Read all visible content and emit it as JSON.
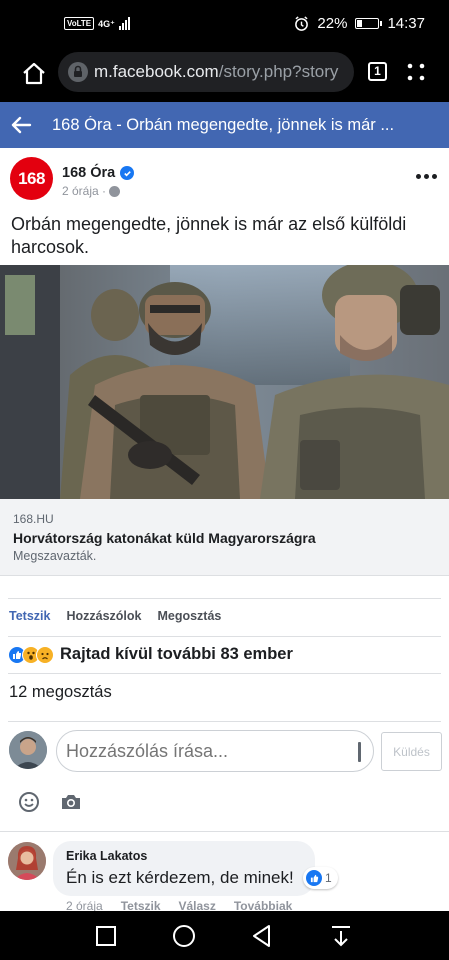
{
  "status_bar": {
    "network": "VoLTE",
    "signal": "4G⁺",
    "battery": "22%",
    "battery_level": 0.22,
    "time": "14:37"
  },
  "browser": {
    "url_host": "m.facebook.com",
    "url_path": "/story.php?story",
    "tab_count": "1",
    "icons": [
      "home-icon",
      "lock-icon",
      "more-vert-icon"
    ]
  },
  "fb_header": {
    "title": "168 Óra - Orbán megengedte, jönnek is már ..."
  },
  "post": {
    "page_logo_text": "168",
    "page_name": "168 Óra",
    "time": "2 órája ·",
    "text": "Orbán megengedte, jönnek is már az első külföldi harcosok.",
    "link": {
      "domain": "168.HU",
      "title": "Horvátország katonákat küld Magyarországra",
      "description": "Megszavazták."
    },
    "actions": {
      "like": "Tetszik",
      "comment": "Hozzászólok",
      "share": "Megosztás"
    },
    "reactions_text": "Rajtad kívül további 83 ember",
    "shares_text": "12 megosztás"
  },
  "composer": {
    "placeholder": "Hozzászólás írása...",
    "send_label": "Küldés"
  },
  "comment": {
    "author": "Erika Lakatos",
    "text": "Én is ezt kérdezem, de minek!",
    "likes": "1",
    "time": "2 órája",
    "like": "Tetszik",
    "reply": "Válasz",
    "more": "Továbbiak"
  },
  "colors": {
    "fb_blue": "#4267b2",
    "like_blue": "#1877f2",
    "brand_red": "#e3000f"
  }
}
